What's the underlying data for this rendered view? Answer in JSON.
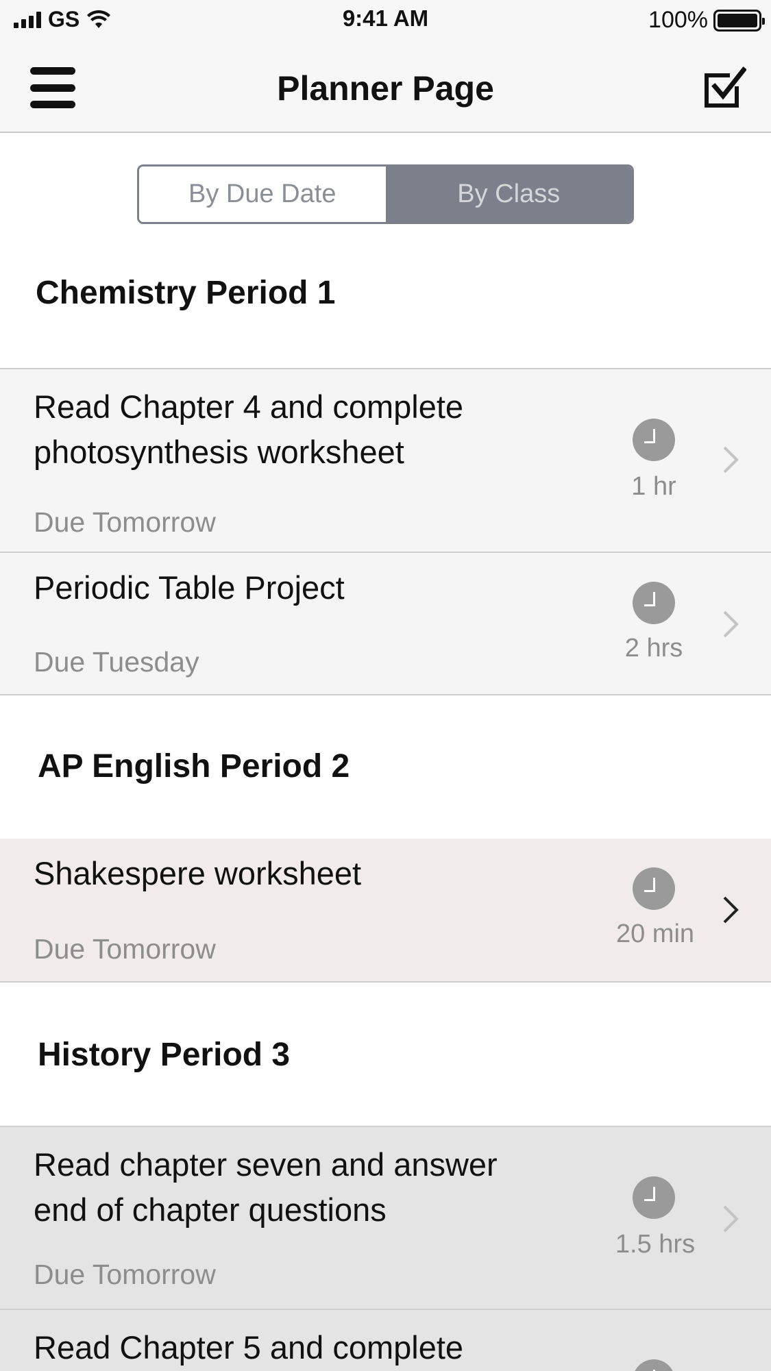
{
  "status_bar": {
    "carrier": "GS",
    "time": "9:41 AM",
    "battery": "100%"
  },
  "nav": {
    "title": "Planner Page",
    "menu_icon": "hamburger-menu-icon",
    "action_icon": "checkbox-checked-icon"
  },
  "segmented": {
    "by_due_date": "By Due Date",
    "by_class": "By Class",
    "selected": "By Class"
  },
  "sections": [
    {
      "title": "Chemistry Period 1"
    },
    {
      "title": "AP English Period 2"
    },
    {
      "title": "History Period 3"
    }
  ],
  "assignments": [
    {
      "title_line1": "Read Chapter 4 and complete",
      "title_line2": "photosynthesis worksheet",
      "due": "Due Tomorrow",
      "duration": "1 hr",
      "background": "#f5f5f5"
    },
    {
      "title_line1": "Periodic Table Project",
      "due": "Due Tuesday",
      "duration": "2 hrs",
      "background": "#f5f5f5"
    },
    {
      "title_line1": "Shakespere worksheet",
      "due": "Due Tomorrow",
      "duration": "20 min",
      "background": "#f1ebeb"
    },
    {
      "title_line1": "Read chapter seven and answer",
      "title_line2": "end of chapter questions",
      "due": "Due Tomorrow",
      "duration": "1.5 hrs",
      "background": "#e4e4e4"
    },
    {
      "title_line1": "Read Chapter 5 and complete",
      "background": "#e4e4e4"
    }
  ],
  "colors": {
    "segment_active": "#7b808a",
    "secondary_text": "#8d8d8d",
    "clock": "#9a9a9a"
  }
}
